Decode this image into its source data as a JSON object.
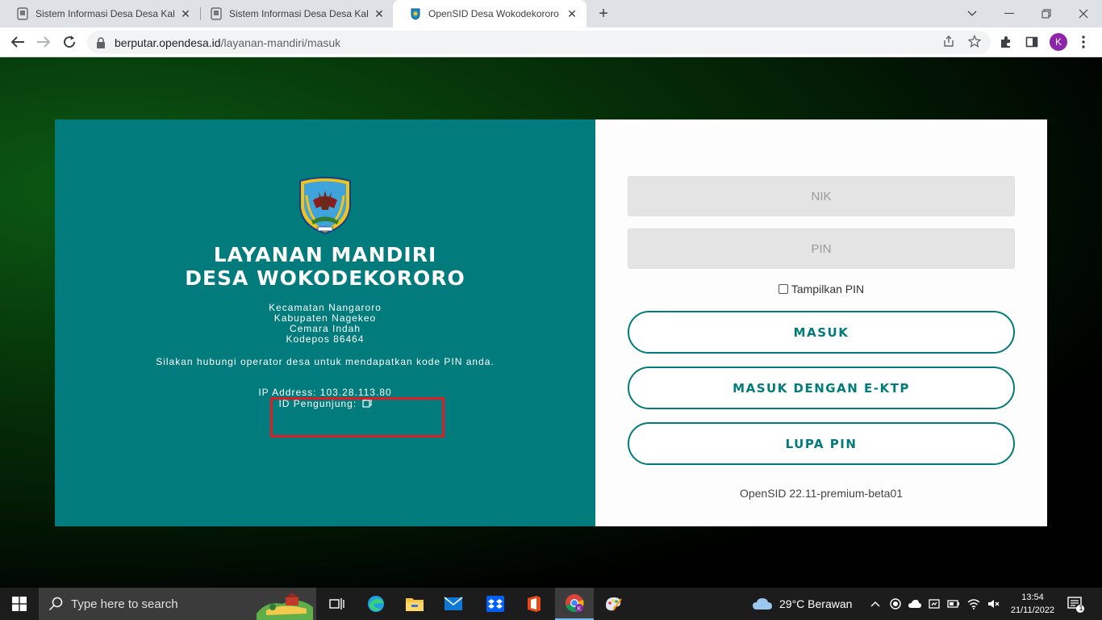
{
  "browser": {
    "tabs": [
      {
        "title": "Sistem Informasi Desa Desa Kalik",
        "active": false
      },
      {
        "title": "Sistem Informasi Desa Desa Kalik",
        "active": false
      },
      {
        "title": "OpenSID Desa Wokodekororo - L",
        "active": true
      }
    ],
    "url_host": "berputar.opendesa.id",
    "url_path": "/layanan-mandiri/masuk",
    "profile_initial": "K"
  },
  "login": {
    "title_line1": "LAYANAN MANDIRI",
    "title_line2": "DESA WOKODEKORORO",
    "kecamatan": "Kecamatan Nangaroro",
    "kabupaten": "Kabupaten Nagekeo",
    "alamat": "Cemara Indah",
    "kodepos": "Kodepos 86464",
    "note": "Silakan hubungi operator desa untuk mendapatkan kode PIN anda.",
    "ip_address": "IP Address: 103.28.113.80",
    "visitor_id": "ID Pengunjung:",
    "nik_placeholder": "NIK",
    "pin_placeholder": "PIN",
    "show_pin_label": "Tampilkan PIN",
    "show_pin_checked": false,
    "btn_masuk": "MASUK",
    "btn_ektp": "MASUK DENGAN E-KTP",
    "btn_lupa": "LUPA PIN",
    "version": "OpenSID 22.11-premium-beta01"
  },
  "taskbar": {
    "search_placeholder": "Type here to search",
    "weather": "29°C  Berawan",
    "time": "13:54",
    "date": "21/11/2022",
    "notification_count": "1"
  },
  "colors": {
    "panel_teal": "#017b7b",
    "highlight_red": "#e01b24"
  }
}
